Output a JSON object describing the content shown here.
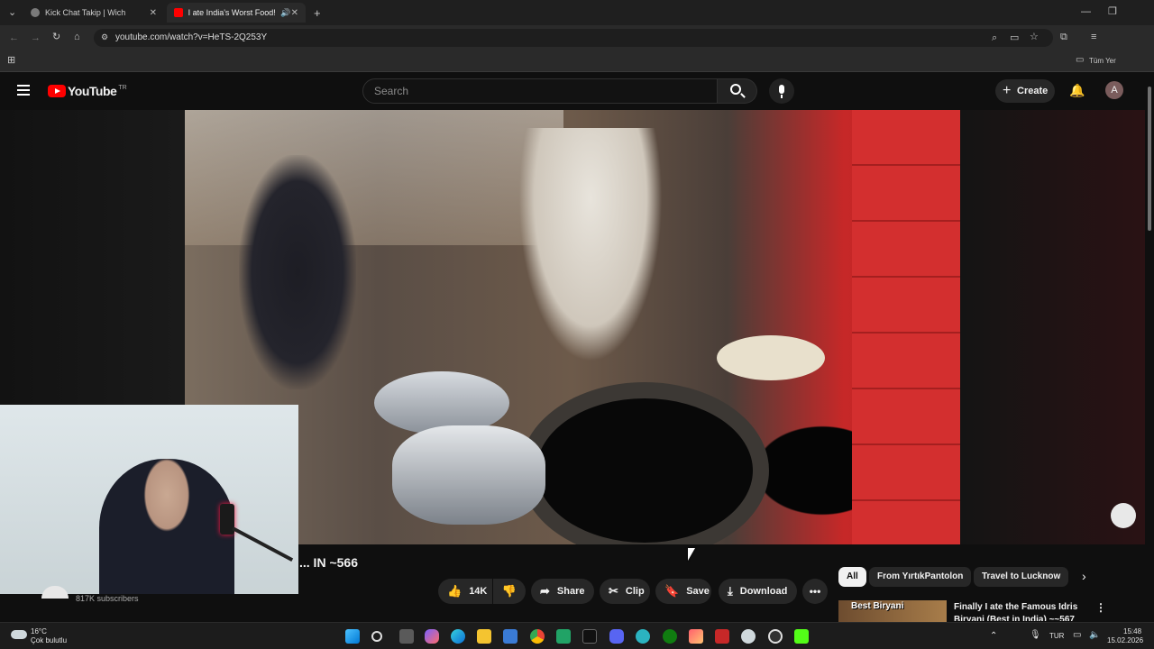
{
  "browser": {
    "tabs": [
      {
        "title": "Kick Chat Takip | Wich",
        "active": false
      },
      {
        "title": "I ate India's Worst Food! IT",
        "active": true
      }
    ],
    "new_tab_icon": "plus-icon",
    "url": "youtube.com/watch?v=HeTS-2Q253Y",
    "bookmark_folder": "Tüm Yer"
  },
  "youtube": {
    "logo": "YouTube",
    "country": "TR",
    "search_placeholder": "Search",
    "create_label": "Create",
    "avatar_letter": "A"
  },
  "video": {
    "title_fragment": "... IN ~566",
    "subscribers": "817K subscribers",
    "likes": "14K",
    "actions": {
      "share": "Share",
      "clip": "Clip",
      "save": "Save",
      "download": "Download"
    }
  },
  "recommendations": {
    "chips": [
      "All",
      "From YırtıkPantolon",
      "Travel to Lucknow"
    ],
    "first": {
      "thumb_text": "Best Biryani",
      "title": "Finally I ate the Famous Idris Biryani (Best in India) ~~567"
    }
  },
  "taskbar": {
    "weather_temp": "16°C",
    "weather_desc": "Çok bulutlu",
    "lang": "TUR",
    "time": "15:48",
    "date": "15.02.2026"
  },
  "colors": {
    "yt_red": "#ff0000",
    "background": "#0f0f0f",
    "chip_active": "#f1f1f1"
  }
}
